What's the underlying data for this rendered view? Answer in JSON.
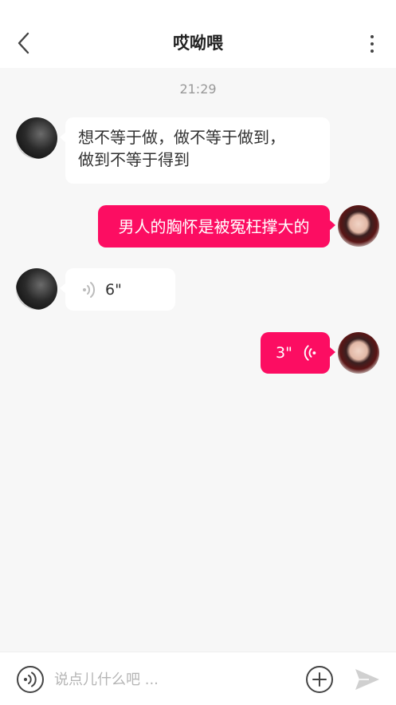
{
  "header": {
    "title": "哎呦喂",
    "back_icon": "chevron-left-icon",
    "more_icon": "more-vertical-icon"
  },
  "timestamp": "21:29",
  "messages": [
    {
      "direction": "incoming",
      "type": "text",
      "text_line1": "想不等于做，做不等于做到，",
      "text_line2": "做到不等于得到",
      "avatar": "male-avatar"
    },
    {
      "direction": "outgoing",
      "type": "text",
      "text": "男人的胸怀是被冤枉撑大的",
      "avatar": "female-avatar"
    },
    {
      "direction": "incoming",
      "type": "voice",
      "duration": "6\"",
      "avatar": "male-avatar"
    },
    {
      "direction": "outgoing",
      "type": "voice",
      "duration": "3\"",
      "avatar": "female-avatar"
    }
  ],
  "input_bar": {
    "placeholder": "说点儿什么吧 ...",
    "voice_icon": "voice-input-icon",
    "plus_icon": "plus-circle-icon",
    "send_icon": "send-icon"
  },
  "colors": {
    "accent": "#fc0d62",
    "background": "#f7f7f7",
    "bubble_incoming": "#ffffff"
  }
}
